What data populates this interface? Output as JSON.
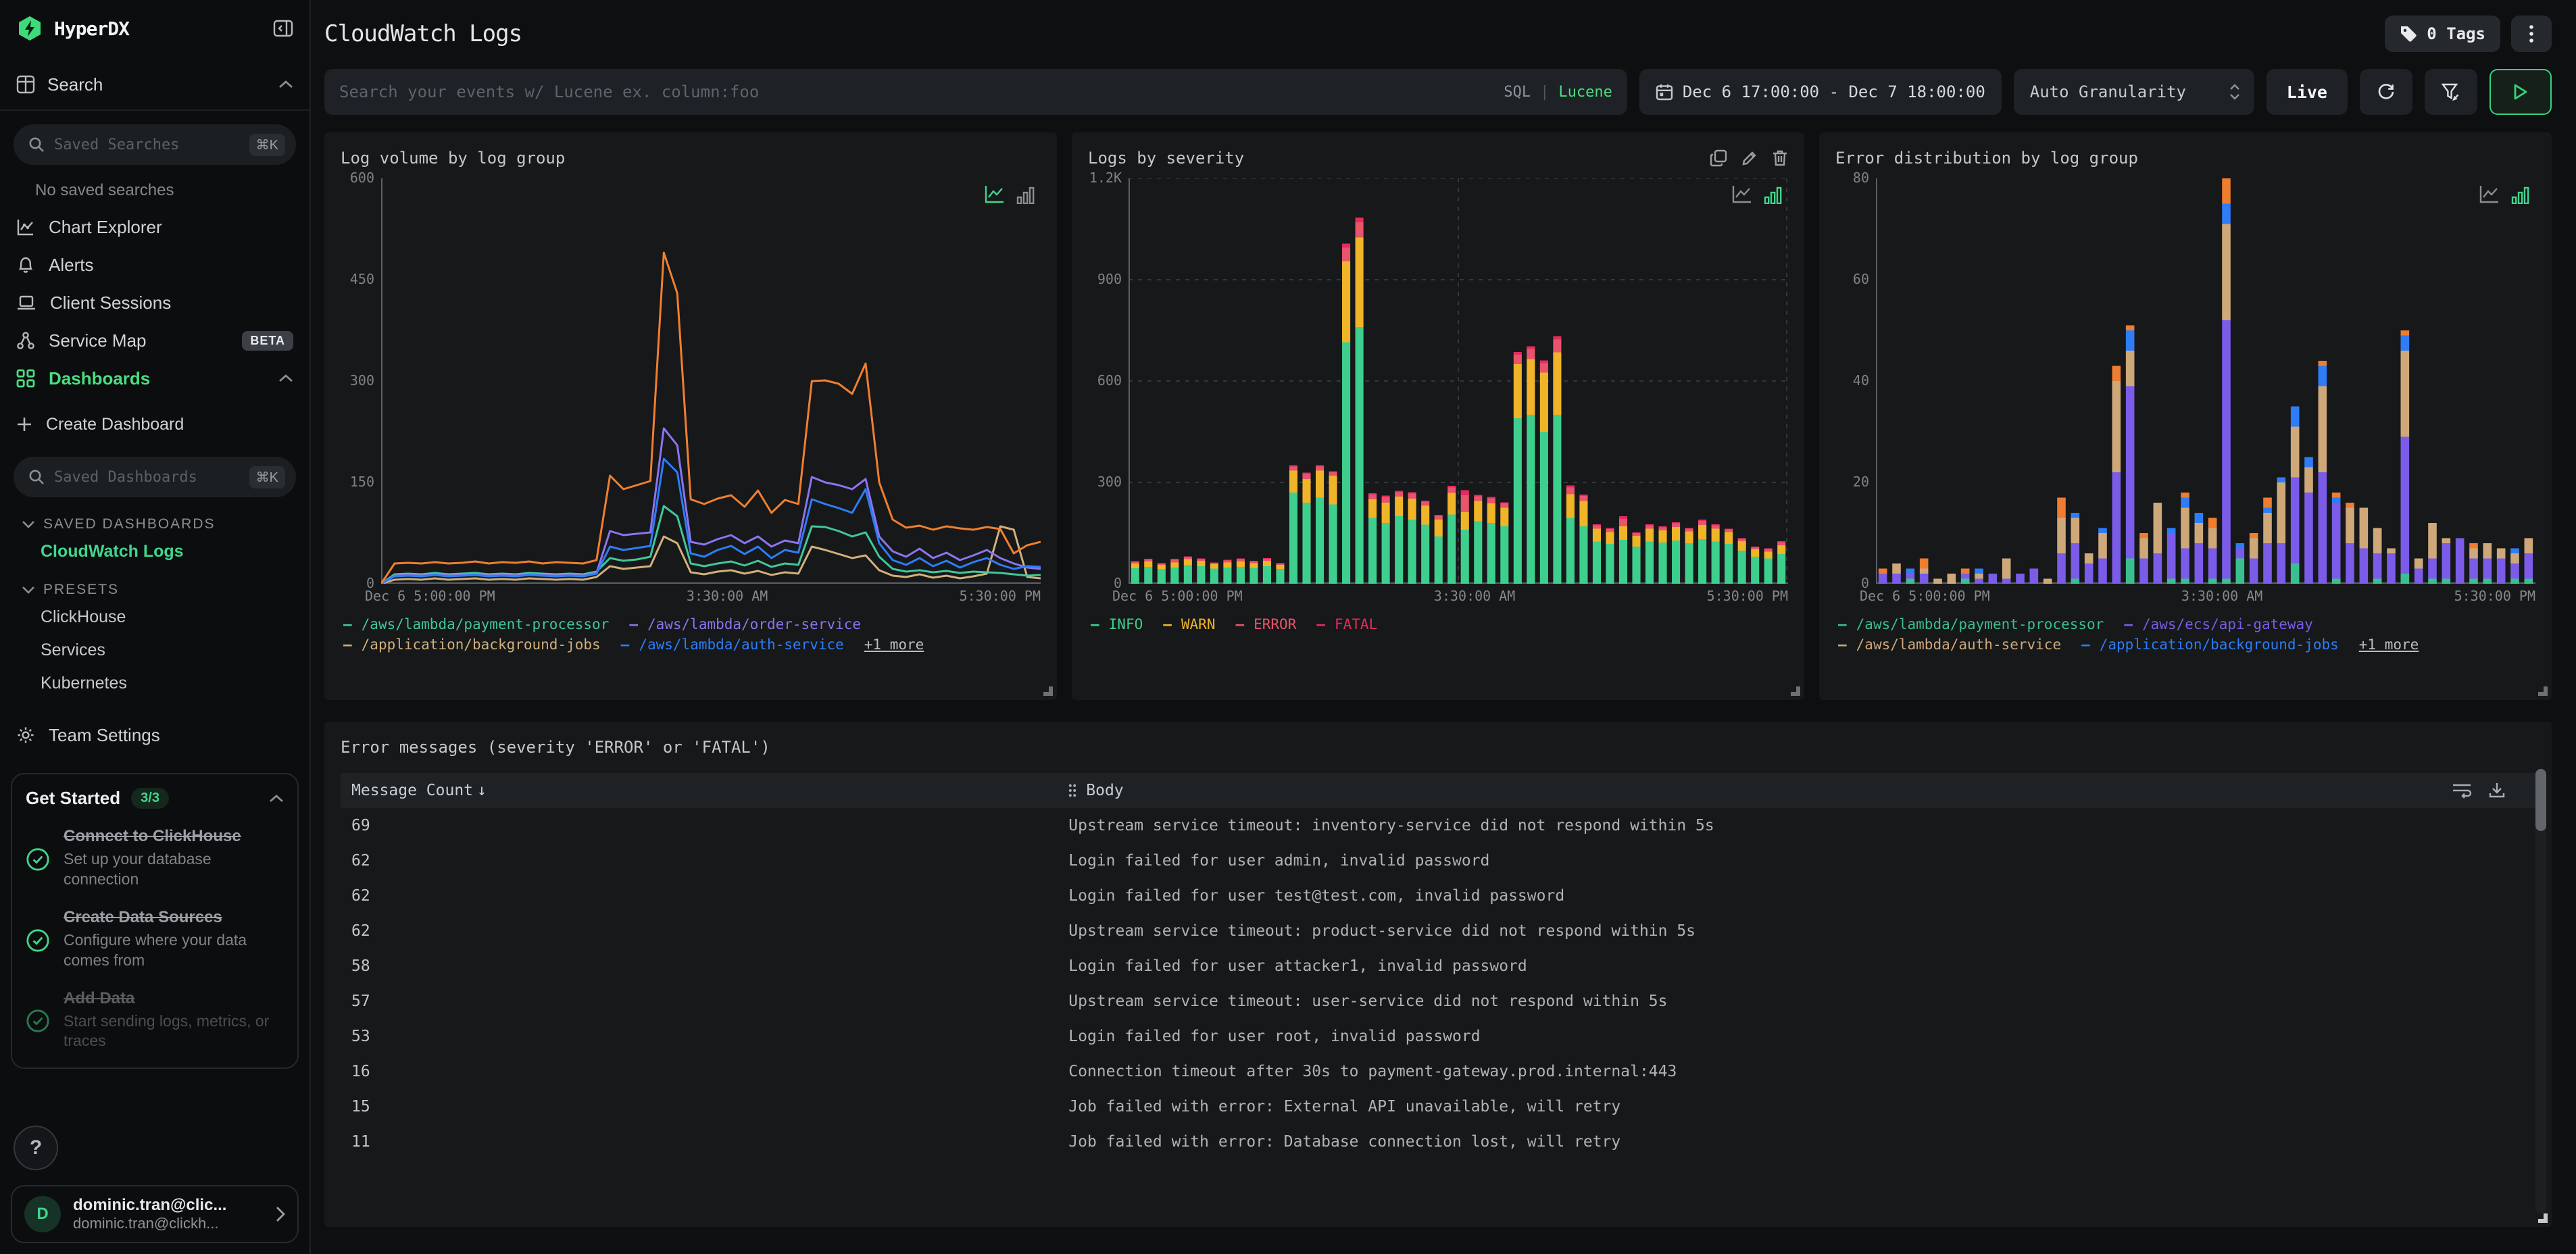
{
  "icons_note": {
    "kebab": "⋮",
    "plus": "+",
    "sort": "↓",
    "help": "?"
  },
  "colors": {
    "accent_green": "#3fd68c",
    "brand_green": "#3ddc7b",
    "panel_bg": "#16181a",
    "page_bg": "#0e0f11"
  },
  "sidebar": {
    "logo": "HyperDX",
    "search_section": "Search",
    "saved_searches_placeholder": "Saved Searches",
    "kbd": "⌘K",
    "no_saved": "No saved searches",
    "nav": [
      {
        "label": "Chart Explorer"
      },
      {
        "label": "Alerts"
      },
      {
        "label": "Client Sessions"
      },
      {
        "label": "Service Map",
        "badge": "BETA"
      },
      {
        "label": "Dashboards"
      }
    ],
    "create_dashboard": "Create Dashboard",
    "saved_dashboards_placeholder": "Saved Dashboards",
    "saved_dashboards_header": "SAVED DASHBOARDS",
    "active_dashboard": "CloudWatch Logs",
    "presets_header": "PRESETS",
    "presets": [
      "ClickHouse",
      "Services",
      "Kubernetes"
    ],
    "team_settings": "Team Settings",
    "get_started": {
      "title": "Get Started",
      "badge": "3/3",
      "items": [
        {
          "title": "Connect to ClickHouse",
          "desc": "Set up your database connection"
        },
        {
          "title": "Create Data Sources",
          "desc": "Configure where your data comes from"
        },
        {
          "title": "Add Data",
          "desc": "Start sending logs, metrics, or traces"
        }
      ]
    },
    "help_label": "?",
    "user": {
      "initial": "D",
      "name": "dominic.tran@clic...",
      "email": "dominic.tran@clickh..."
    }
  },
  "header": {
    "title": "CloudWatch Logs",
    "tags_label": "0 Tags"
  },
  "toolbar": {
    "search_placeholder": "Search your events w/ Lucene ex. column:foo",
    "sql_label": "SQL",
    "lang_sep": "|",
    "lucene_label": "Lucene",
    "date_range": "Dec 6 17:00:00 - Dec 7 18:00:00",
    "granularity": "Auto Granularity",
    "live_label": "Live"
  },
  "chart_data": [
    {
      "type": "line",
      "title": "Log volume by log group",
      "active_view": "line",
      "ymax": 600,
      "yticks": [
        {
          "label": "600",
          "value": 600
        },
        {
          "label": "450",
          "value": 450
        },
        {
          "label": "300",
          "value": 300
        },
        {
          "label": "150",
          "value": 150
        },
        {
          "label": "0",
          "value": 0
        }
      ],
      "xticks": [
        "Dec 6 5:00:00 PM",
        "3:30:00 AM",
        "5:30:00 PM"
      ],
      "grid": false,
      "series": [
        {
          "name": "/application/background-jobs",
          "color": "#d2b07c",
          "values": [
            0,
            6,
            7,
            6,
            8,
            6,
            7,
            8,
            6,
            7,
            6,
            8,
            7,
            6,
            7,
            6,
            10,
            26,
            22,
            24,
            26,
            70,
            60,
            17,
            14,
            18,
            20,
            15,
            19,
            13,
            17,
            15,
            55,
            50,
            44,
            38,
            42,
            20,
            12,
            10,
            14,
            9,
            12,
            8,
            11,
            15,
            85,
            80,
            10,
            8
          ]
        },
        {
          "name": "/aws/lambda/payment-processor",
          "color": "#41c79a",
          "values": [
            0,
            14,
            15,
            14,
            16,
            14,
            15,
            16,
            14,
            15,
            14,
            16,
            15,
            14,
            15,
            14,
            18,
            38,
            34,
            36,
            40,
            115,
            100,
            30,
            26,
            30,
            33,
            27,
            34,
            25,
            30,
            28,
            85,
            84,
            78,
            70,
            76,
            40,
            22,
            18,
            20,
            17,
            19,
            16,
            18,
            17,
            16,
            14,
            12,
            13
          ]
        },
        {
          "name": "/aws/lambda/order-service",
          "color": "#8b74f0",
          "values": [
            0,
            12,
            13,
            12,
            14,
            12,
            13,
            14,
            12,
            13,
            12,
            14,
            13,
            12,
            13,
            12,
            16,
            78,
            72,
            74,
            76,
            230,
            205,
            62,
            58,
            66,
            72,
            60,
            70,
            55,
            64,
            60,
            158,
            150,
            146,
            140,
            155,
            70,
            48,
            40,
            52,
            38,
            46,
            35,
            42,
            50,
            38,
            30,
            24,
            22
          ]
        },
        {
          "name": "/aws/lambda/auth-service",
          "color": "#2e7df6",
          "values": [
            0,
            11,
            12,
            11,
            13,
            11,
            12,
            13,
            11,
            12,
            11,
            13,
            12,
            11,
            12,
            11,
            15,
            55,
            50,
            53,
            56,
            185,
            165,
            45,
            40,
            50,
            56,
            44,
            55,
            38,
            50,
            46,
            125,
            118,
            112,
            105,
            140,
            60,
            35,
            28,
            38,
            26,
            34,
            24,
            32,
            38,
            28,
            22,
            26,
            25
          ]
        },
        {
          "name": "other (+1 more)",
          "color": "#f07f2f",
          "values": [
            0,
            30,
            31,
            30,
            32,
            30,
            31,
            33,
            30,
            32,
            31,
            33,
            30,
            32,
            31,
            30,
            35,
            160,
            140,
            146,
            152,
            490,
            430,
            125,
            118,
            126,
            131,
            114,
            138,
            105,
            124,
            118,
            300,
            301,
            296,
            281,
            326,
            150,
            95,
            83,
            86,
            80,
            85,
            82,
            80,
            84,
            81,
            45,
            57,
            62
          ]
        }
      ],
      "legend_rows": [
        [
          {
            "label": "/aws/lambda/payment-processor",
            "color": "#41c79a"
          },
          {
            "label": "/aws/lambda/order-service",
            "color": "#8b74f0"
          }
        ],
        [
          {
            "label": "/application/background-jobs",
            "color": "#d2b07c"
          },
          {
            "label": "/aws/lambda/auth-service",
            "color": "#2e7df6"
          },
          {
            "label": "+1 more",
            "muted": true
          }
        ]
      ]
    },
    {
      "type": "bar",
      "title": "Logs by severity",
      "active_view": "bar",
      "has_hover_actions": true,
      "ymax": 1200,
      "yticks": [
        {
          "label": "1.2K",
          "value": 1200
        },
        {
          "label": "900",
          "value": 900
        },
        {
          "label": "600",
          "value": 600
        },
        {
          "label": "300",
          "value": 300
        },
        {
          "label": "0",
          "value": 0
        }
      ],
      "xticks": [
        "Dec 6 5:00:00 PM",
        "3:30:00 AM",
        "5:30:00 PM"
      ],
      "grid": true,
      "series": [
        {
          "name": "INFO",
          "color": "#3ecf8e",
          "values": [
            46,
            50,
            44,
            48,
            55,
            52,
            45,
            48,
            50,
            47,
            52,
            44,
            270,
            240,
            255,
            235,
            715,
            760,
            195,
            180,
            200,
            190,
            175,
            140,
            205,
            160,
            185,
            180,
            170,
            490,
            500,
            450,
            500,
            195,
            170,
            125,
            118,
            130,
            110,
            125,
            122,
            128,
            120,
            132,
            125,
            118,
            98,
            80,
            75,
            88
          ]
        },
        {
          "name": "WARN",
          "color": "#f0b429",
          "values": [
            14,
            16,
            12,
            15,
            18,
            16,
            13,
            15,
            16,
            14,
            16,
            12,
            65,
            70,
            80,
            85,
            240,
            265,
            55,
            60,
            58,
            62,
            56,
            50,
            64,
            52,
            60,
            58,
            55,
            160,
            165,
            175,
            185,
            70,
            75,
            38,
            35,
            40,
            32,
            38,
            36,
            40,
            35,
            42,
            38,
            35,
            28,
            22,
            20,
            26
          ]
        },
        {
          "name": "ERROR",
          "color": "#e8546c",
          "values": [
            5,
            6,
            4,
            8,
            6,
            5,
            4,
            6,
            7,
            5,
            6,
            4,
            12,
            15,
            12,
            10,
            40,
            45,
            14,
            16,
            13,
            15,
            12,
            11,
            16,
            50,
            14,
            15,
            13,
            28,
            30,
            28,
            38,
            20,
            15,
            10,
            9,
            22,
            8,
            10,
            9,
            11,
            8,
            12,
            10,
            8,
            7,
            6,
            8,
            9
          ]
        },
        {
          "name": "FATAL",
          "color": "#e52b5e",
          "values": [
            2,
            2,
            1,
            3,
            2,
            2,
            1,
            2,
            2,
            2,
            2,
            1,
            4,
            4,
            4,
            3,
            12,
            14,
            4,
            5,
            4,
            4,
            3,
            3,
            5,
            15,
            4,
            4,
            3,
            8,
            8,
            8,
            10,
            6,
            4,
            3,
            3,
            8,
            2,
            3,
            3,
            3,
            2,
            4,
            3,
            2,
            2,
            2,
            2,
            3
          ]
        }
      ],
      "legend_rows": [
        [
          {
            "label": "INFO",
            "color": "#3ecf8e"
          },
          {
            "label": "WARN",
            "color": "#f0b429"
          },
          {
            "label": "ERROR",
            "color": "#e8546c"
          },
          {
            "label": "FATAL",
            "color": "#e52b5e"
          }
        ]
      ]
    },
    {
      "type": "bar",
      "title": "Error distribution by log group",
      "active_view": "bar",
      "ymax": 80,
      "yticks": [
        {
          "label": "80",
          "value": 80
        },
        {
          "label": "60",
          "value": 60
        },
        {
          "label": "40",
          "value": 40
        },
        {
          "label": "20",
          "value": 20
        },
        {
          "label": "0",
          "value": 0
        }
      ],
      "xticks": [
        "Dec 6 5:00:00 PM",
        "3:30:00 AM",
        "5:30:00 PM"
      ],
      "grid": false,
      "series": [
        {
          "name": "/aws/lambda/payment-processor",
          "color": "#3cbf8e",
          "values": [
            0,
            0,
            1,
            0,
            0,
            0,
            1,
            0,
            0,
            0,
            0,
            0,
            0,
            0,
            1,
            0,
            0,
            0,
            5,
            0,
            0,
            1,
            1,
            0,
            1,
            1,
            5,
            0,
            0,
            0,
            4,
            0,
            0,
            1,
            0,
            0,
            1,
            0,
            2,
            0,
            1,
            1,
            0,
            1,
            1,
            0,
            1,
            1
          ]
        },
        {
          "name": "/aws/ecs/api-gateway",
          "color": "#7a5ce8",
          "values": [
            2,
            2,
            1,
            2,
            0,
            0,
            1,
            1,
            2,
            1,
            2,
            3,
            0,
            6,
            7,
            4,
            5,
            22,
            34,
            5,
            6,
            9,
            6,
            8,
            6,
            51,
            2,
            5,
            8,
            8,
            17,
            18,
            22,
            15,
            8,
            7,
            5,
            6,
            27,
            3,
            4,
            7,
            9,
            4,
            4,
            5,
            3,
            5
          ]
        },
        {
          "name": "/aws/lambda/auth-service",
          "color": "#cfa87a",
          "values": [
            0,
            2,
            0,
            1,
            1,
            2,
            0,
            1,
            0,
            4,
            0,
            0,
            1,
            7,
            5,
            2,
            5,
            18,
            7,
            4,
            10,
            0,
            8,
            4,
            4,
            19,
            0,
            4,
            6,
            12,
            10,
            5,
            17,
            0,
            7,
            8,
            5,
            1,
            17,
            2,
            7,
            1,
            0,
            2,
            3,
            2,
            2,
            3
          ]
        },
        {
          "name": "/application/background-jobs",
          "color": "#2e7df6",
          "values": [
            0,
            0,
            1,
            0,
            0,
            0,
            0,
            1,
            0,
            0,
            0,
            0,
            0,
            0,
            1,
            0,
            1,
            0,
            4,
            0,
            0,
            1,
            2,
            2,
            0,
            4,
            1,
            0,
            1,
            1,
            4,
            2,
            4,
            1,
            0,
            0,
            0,
            0,
            3,
            0,
            0,
            0,
            0,
            0,
            0,
            0,
            1,
            0
          ]
        },
        {
          "name": "other (+1 more)",
          "color": "#ee7d2f",
          "values": [
            1,
            0,
            0,
            2,
            0,
            0,
            1,
            0,
            0,
            0,
            0,
            0,
            0,
            4,
            0,
            0,
            0,
            3,
            1,
            1,
            0,
            0,
            1,
            0,
            2,
            5,
            0,
            1,
            2,
            0,
            0,
            0,
            1,
            1,
            1,
            0,
            0,
            0,
            1,
            0,
            0,
            0,
            0,
            1,
            0,
            0,
            0,
            0
          ]
        }
      ],
      "legend_rows": [
        [
          {
            "label": "/aws/lambda/payment-processor",
            "color": "#3cbf8e"
          },
          {
            "label": "/aws/ecs/api-gateway",
            "color": "#7a5ce8"
          }
        ],
        [
          {
            "label": "/aws/lambda/auth-service",
            "color": "#cfa87a"
          },
          {
            "label": "/application/background-jobs",
            "color": "#2e7df6"
          },
          {
            "label": "+1 more",
            "muted": true
          }
        ]
      ]
    }
  ],
  "table": {
    "title": "Error messages (severity 'ERROR' or 'FATAL')",
    "col_count": "Message Count",
    "sort_icon": "↓",
    "col_body": "Body",
    "rows": [
      {
        "count": "69",
        "body": "Upstream service timeout: inventory-service did not respond within 5s"
      },
      {
        "count": "62",
        "body": "Login failed for user admin, invalid password"
      },
      {
        "count": "62",
        "body": "Login failed for user test@test.com, invalid password"
      },
      {
        "count": "62",
        "body": "Upstream service timeout: product-service did not respond within 5s"
      },
      {
        "count": "58",
        "body": "Login failed for user attacker1, invalid password"
      },
      {
        "count": "57",
        "body": "Upstream service timeout: user-service did not respond within 5s"
      },
      {
        "count": "53",
        "body": "Login failed for user root, invalid password"
      },
      {
        "count": "16",
        "body": "Connection timeout after 30s to payment-gateway.prod.internal:443"
      },
      {
        "count": "15",
        "body": "Job failed with error: External API unavailable, will retry"
      },
      {
        "count": "11",
        "body": "Job failed with error: Database connection lost, will retry"
      }
    ]
  }
}
